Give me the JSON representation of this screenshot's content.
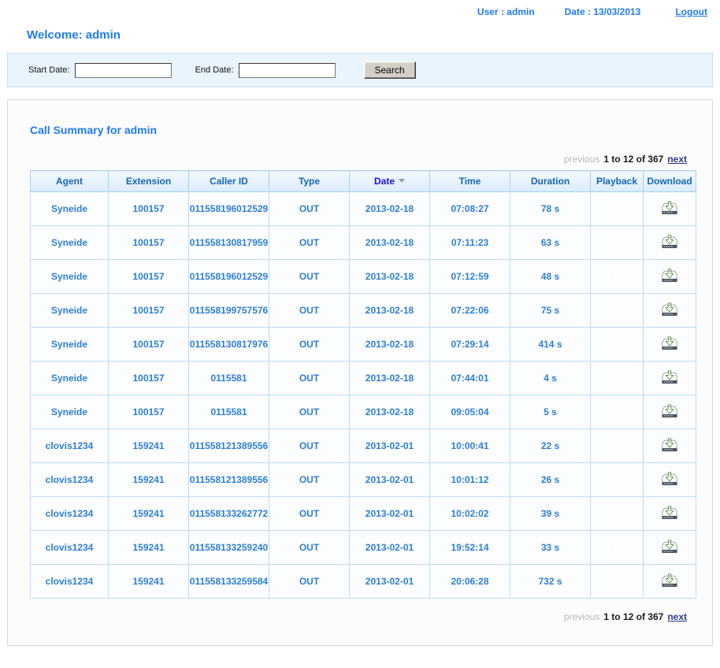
{
  "topbar": {
    "user_label": "User : admin",
    "date_label": "Date : 13/03/2013",
    "logout_label": "Logout"
  },
  "welcome": {
    "text": "Welcome: admin"
  },
  "search": {
    "start_date_label": "Start Date:",
    "start_date_value": "",
    "start_date_placeholder": "",
    "end_date_label": "End Date:",
    "end_date_value": "",
    "end_date_placeholder": "",
    "search_button_label": "Search"
  },
  "section": {
    "title": "Call Summary for admin"
  },
  "pagination": {
    "previous_label": "previous",
    "range_label": "1 to 12 of 367",
    "next_label": "next"
  },
  "table": {
    "columns": [
      "Agent",
      "Extension",
      "Caller ID",
      "Type",
      "Date",
      "Time",
      "Duration",
      "Playback",
      "Download"
    ],
    "sorted_column": "Date",
    "sort_direction": "desc",
    "playback_icon": "play-icon",
    "download_icon": "download-icon",
    "rows": [
      {
        "agent": "Syneide",
        "extension": "100157",
        "caller_id": "011558196012529",
        "type": "OUT",
        "date": "2013-02-18",
        "time": "07:08:27",
        "duration": "78 s"
      },
      {
        "agent": "Syneide",
        "extension": "100157",
        "caller_id": "011558130817959",
        "type": "OUT",
        "date": "2013-02-18",
        "time": "07:11:23",
        "duration": "63 s"
      },
      {
        "agent": "Syneide",
        "extension": "100157",
        "caller_id": "011558196012529",
        "type": "OUT",
        "date": "2013-02-18",
        "time": "07:12:59",
        "duration": "48 s"
      },
      {
        "agent": "Syneide",
        "extension": "100157",
        "caller_id": "011558199757576",
        "type": "OUT",
        "date": "2013-02-18",
        "time": "07:22:06",
        "duration": "75 s"
      },
      {
        "agent": "Syneide",
        "extension": "100157",
        "caller_id": "011558130817976",
        "type": "OUT",
        "date": "2013-02-18",
        "time": "07:29:14",
        "duration": "414 s"
      },
      {
        "agent": "Syneide",
        "extension": "100157",
        "caller_id": "0115581",
        "type": "OUT",
        "date": "2013-02-18",
        "time": "07:44:01",
        "duration": "4 s"
      },
      {
        "agent": "Syneide",
        "extension": "100157",
        "caller_id": "0115581",
        "type": "OUT",
        "date": "2013-02-18",
        "time": "09:05:04",
        "duration": "5 s"
      },
      {
        "agent": "clovis1234",
        "extension": "159241",
        "caller_id": "011558121389556",
        "type": "OUT",
        "date": "2013-02-01",
        "time": "10:00:41",
        "duration": "22 s"
      },
      {
        "agent": "clovis1234",
        "extension": "159241",
        "caller_id": "011558121389556",
        "type": "OUT",
        "date": "2013-02-01",
        "time": "10:01:12",
        "duration": "26 s"
      },
      {
        "agent": "clovis1234",
        "extension": "159241",
        "caller_id": "011558133262772",
        "type": "OUT",
        "date": "2013-02-01",
        "time": "10:02:02",
        "duration": "39 s"
      },
      {
        "agent": "clovis1234",
        "extension": "159241",
        "caller_id": "011558133259240",
        "type": "OUT",
        "date": "2013-02-01",
        "time": "19:52:14",
        "duration": "33 s"
      },
      {
        "agent": "clovis1234",
        "extension": "159241",
        "caller_id": "011558133259584",
        "type": "OUT",
        "date": "2013-02-01",
        "time": "20:06:28",
        "duration": "732 s"
      }
    ]
  },
  "colors": {
    "link_blue": "#1f7bf0",
    "header_text": "#1866b3",
    "cell_text": "#2d7fd4",
    "panel_bg": "#eaf4fc",
    "download_arrow_green": "#6fbf3a"
  }
}
